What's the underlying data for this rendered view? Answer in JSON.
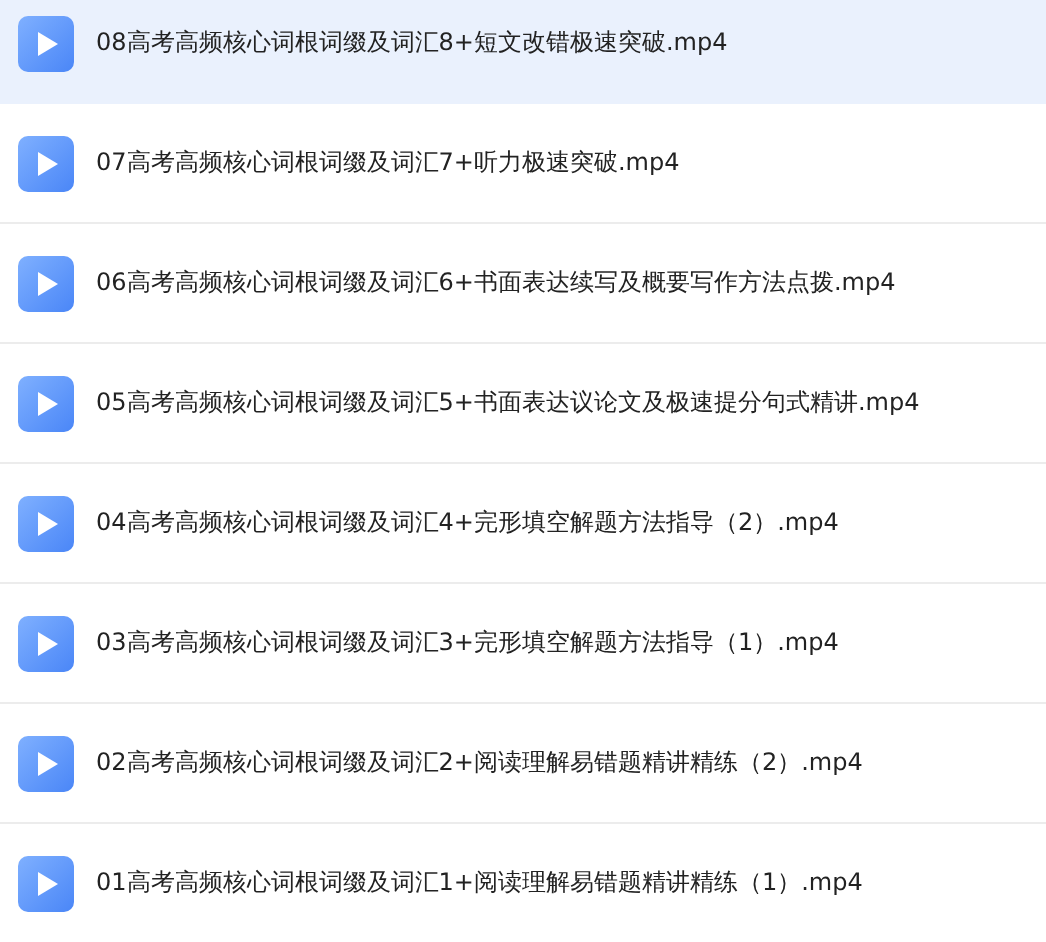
{
  "files": [
    {
      "name": "08高考高频核心词根词缀及词汇8+短文改错极速突破.mp4",
      "selected": true
    },
    {
      "name": "07高考高频核心词根词缀及词汇7+听力极速突破.mp4",
      "selected": false
    },
    {
      "name": "06高考高频核心词根词缀及词汇6+书面表达续写及概要写作方法点拨.mp4",
      "selected": false
    },
    {
      "name": "05高考高频核心词根词缀及词汇5+书面表达议论文及极速提分句式精讲.mp4",
      "selected": false
    },
    {
      "name": "04高考高频核心词根词缀及词汇4+完形填空解题方法指导（2）.mp4",
      "selected": false
    },
    {
      "name": "03高考高频核心词根词缀及词汇3+完形填空解题方法指导（1）.mp4",
      "selected": false
    },
    {
      "name": "02高考高频核心词根词缀及词汇2+阅读理解易错题精讲精练（2）.mp4",
      "selected": false
    },
    {
      "name": "01高考高频核心词根词缀及词汇1+阅读理解易错题精讲精练（1）.mp4",
      "selected": false
    }
  ]
}
